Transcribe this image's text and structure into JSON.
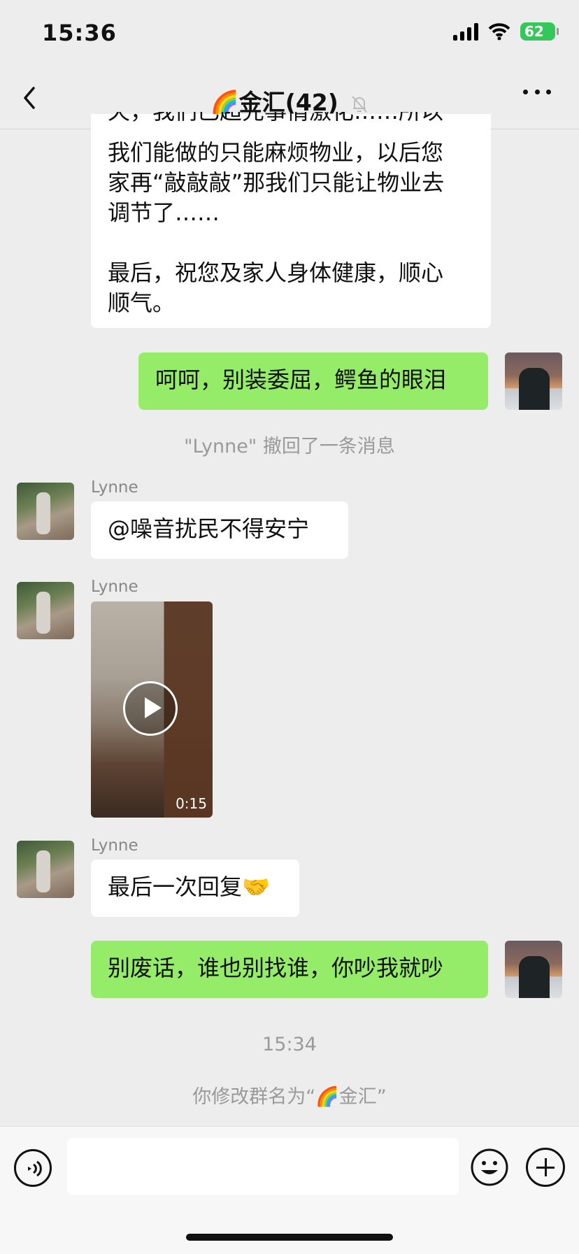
{
  "status_bar": {
    "time": "15:36",
    "battery": "62"
  },
  "header": {
    "title": "🌈金汇",
    "member_count": "(42)"
  },
  "messages": [
    {
      "type": "text",
      "side": "left",
      "text_lines": [
        "天，我们已超先事情激化……所以",
        "我们能做的只能麻烦物业，以后您",
        "家再“敲敲敲”那我们只能让物业去",
        "调节了……",
        "",
        "最后，祝您及家人身体健康，顺心",
        "顺气。"
      ]
    },
    {
      "type": "text",
      "side": "right",
      "text": "呵呵，别装委屈，鳄鱼的眼泪"
    },
    {
      "type": "system",
      "text": "\"Lynne\" 撤回了一条消息"
    },
    {
      "type": "text",
      "side": "left",
      "sender": "Lynne",
      "text": "@噪音扰民不得安宁"
    },
    {
      "type": "video",
      "side": "left",
      "sender": "Lynne",
      "duration": "0:15"
    },
    {
      "type": "text",
      "side": "left",
      "sender": "Lynne",
      "text": "最后一次回复🤝"
    },
    {
      "type": "text",
      "side": "right",
      "text": "别废话，谁也别找谁，你吵我就吵"
    },
    {
      "type": "time",
      "text": "15:34"
    },
    {
      "type": "system",
      "text": "你修改群名为“🌈金汇”"
    }
  ],
  "input": {
    "placeholder": ""
  },
  "icons": {
    "back": "chevron-left-icon",
    "more": "more-dots-icon",
    "mute": "bell-off-icon",
    "voice": "voice-icon",
    "emoji": "emoji-icon",
    "plus": "plus-icon"
  }
}
